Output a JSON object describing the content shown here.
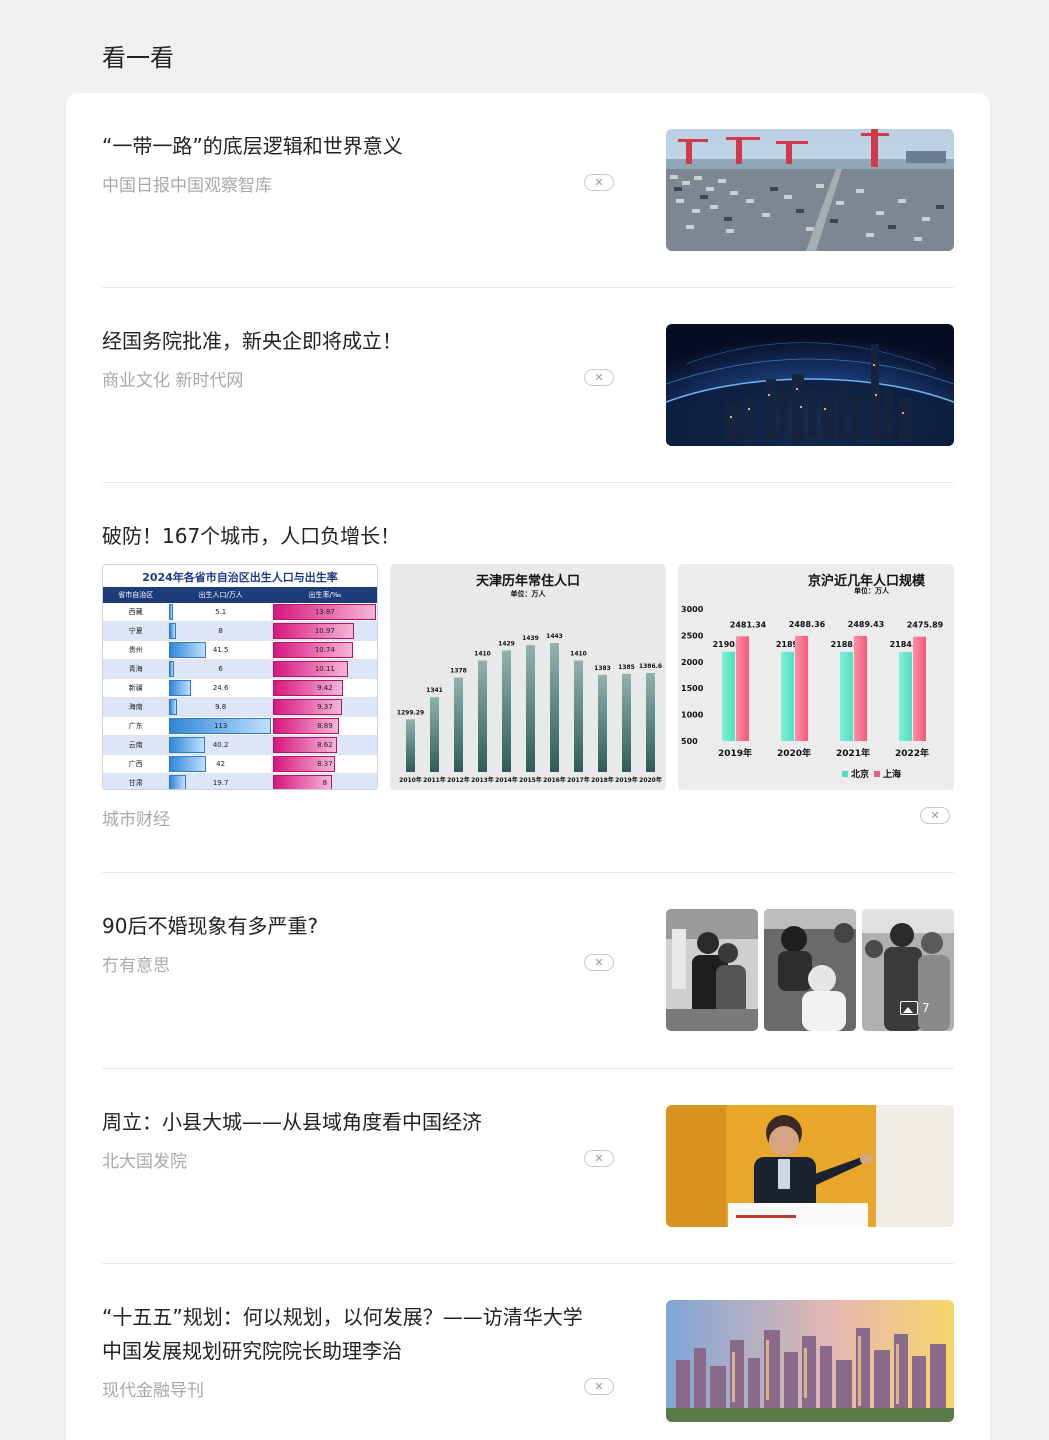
{
  "page": {
    "title": "看一看"
  },
  "icons": {
    "close": "close-icon",
    "gallery": "gallery-icon"
  },
  "items": [
    {
      "title": "“一带一路”的底层逻辑和世界意义",
      "source": "中国日报中国观察智库",
      "close": "✕"
    },
    {
      "title": "经国务院批准，新央企即将成立！",
      "source": "商业文化 新时代网",
      "close": "✕"
    },
    {
      "title": "破防！167个城市，人口负增长！",
      "source": "城市财经",
      "close": "✕"
    },
    {
      "title": "90后不婚现象有多严重?",
      "source": "冇有意思",
      "close": "✕",
      "gallery_count": "7"
    },
    {
      "title": "周立：小县大城——从县域角度看中国经济",
      "source": "北大国发院",
      "close": "✕"
    },
    {
      "title_line1": "“十五五”规划：何以规划，以何发展？——访清华大学",
      "title_line2": "中国发展规划研究院院长助理李治",
      "source": "现代金融导刊",
      "close": "✕"
    }
  ],
  "chart_data": [
    {
      "type": "table",
      "title": "2024年各省市自治区出生人口与出生率",
      "columns": [
        "省市自治区",
        "出生人口/万人",
        "出生率/‰"
      ],
      "rows": [
        [
          "西藏",
          "5.1",
          "13.87"
        ],
        [
          "宁夏",
          "8",
          "10.97"
        ],
        [
          "贵州",
          "41.5",
          "10.74"
        ],
        [
          "青海",
          "6",
          "10.11"
        ],
        [
          "新疆",
          "24.6",
          "9.42"
        ],
        [
          "海南",
          "9.8",
          "9.37"
        ],
        [
          "广东",
          "113",
          "8.89"
        ],
        [
          "云南",
          "40.2",
          "8.62"
        ],
        [
          "广西",
          "42",
          "8.37"
        ],
        [
          "甘肃",
          "19.7",
          "8"
        ]
      ]
    },
    {
      "type": "bar",
      "title": "天津历年常住人口",
      "subtitle": "单位：万人",
      "categories": [
        "2010年",
        "2011年",
        "2012年",
        "2013年",
        "2014年",
        "2015年",
        "2016年",
        "2017年",
        "2018年",
        "2019年",
        "2020年"
      ],
      "values": [
        1299.29,
        1341,
        1378,
        1410,
        1429,
        1439,
        1443,
        1410,
        1383,
        1385,
        1386.6
      ],
      "color": "#2f5c5a"
    },
    {
      "type": "bar",
      "title": "京沪近几年人口规模",
      "subtitle": "单位：万人",
      "categories": [
        "2019年",
        "2020年",
        "2021年",
        "2022年"
      ],
      "yticks": [
        "3000",
        "2500",
        "2000",
        "1500",
        "1000",
        "500"
      ],
      "ylim": [
        500,
        3000
      ],
      "series": [
        {
          "name": "北京",
          "values": [
            2190.1,
            2189,
            2188.6,
            2184.3
          ],
          "color": "#4fe0c0"
        },
        {
          "name": "上海",
          "values": [
            2481.34,
            2488.36,
            2489.43,
            2475.89
          ],
          "color": "#f25a78"
        }
      ]
    }
  ]
}
